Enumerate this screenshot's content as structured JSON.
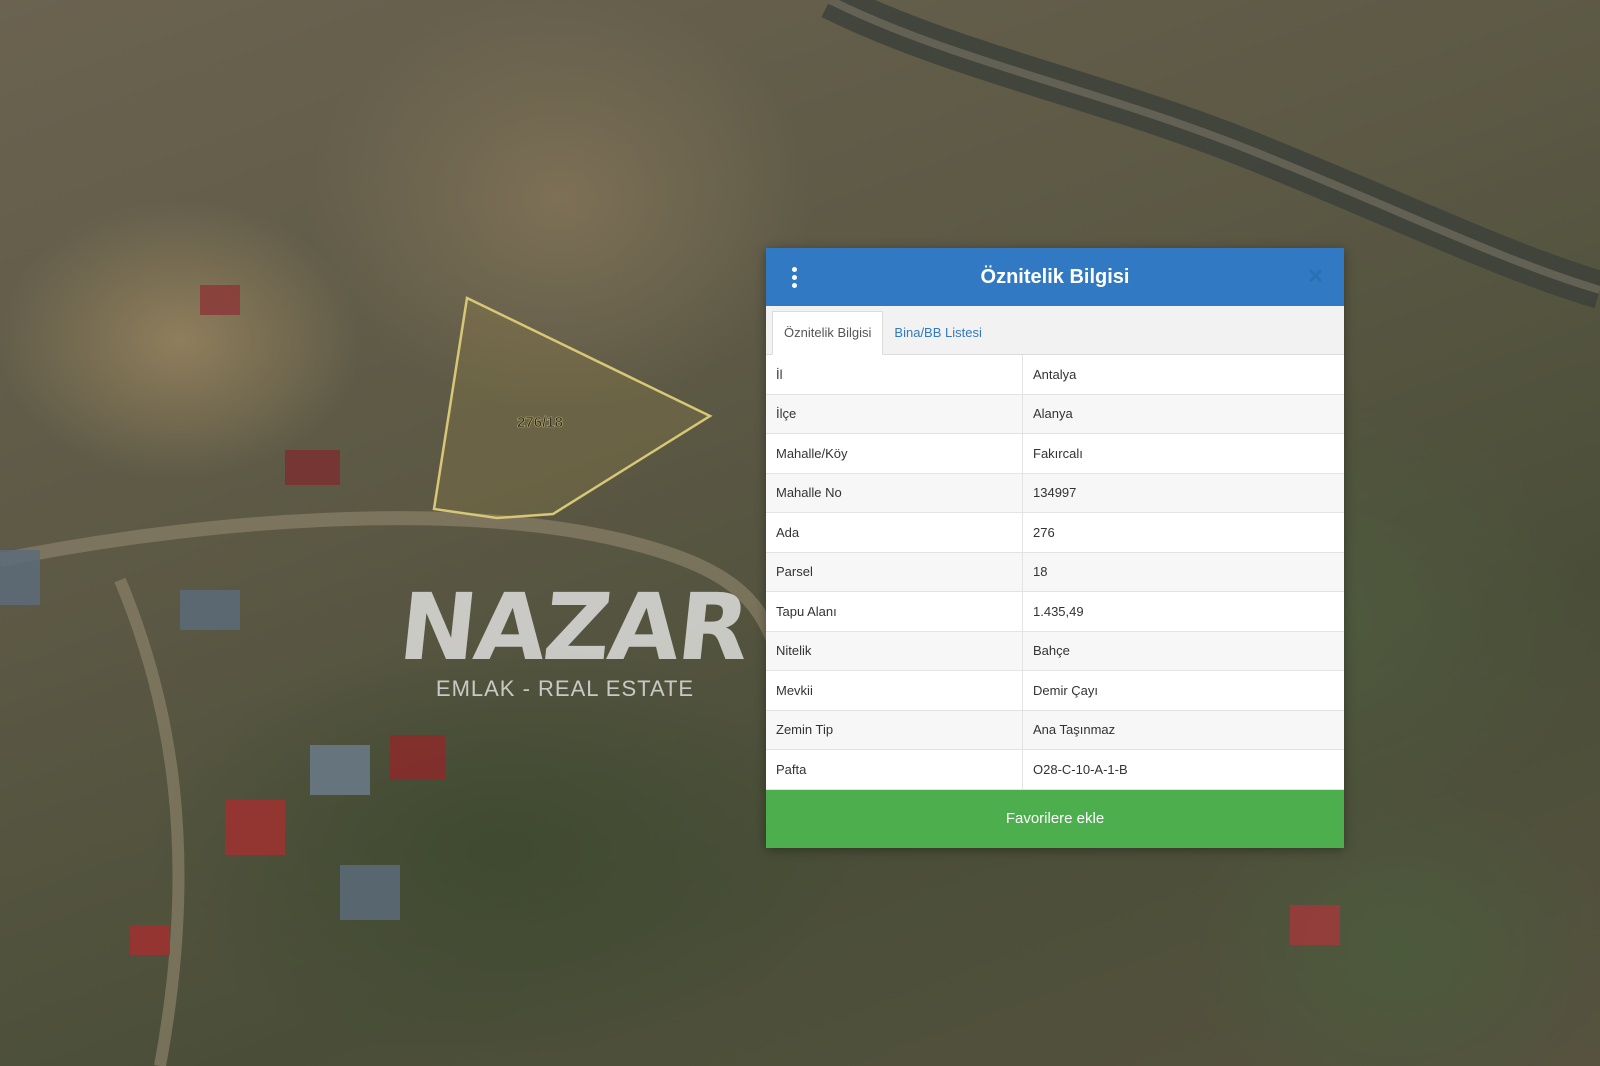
{
  "map": {
    "parcel_label": "276/18"
  },
  "watermark": {
    "logo": "NAZAR",
    "tagline": "EMLAK - REAL ESTATE"
  },
  "dialog": {
    "title": "Öznitelik Bilgisi",
    "tabs": [
      {
        "label": "Öznitelik Bilgisi",
        "active": true
      },
      {
        "label": "Bina/BB Listesi",
        "active": false
      }
    ],
    "rows": [
      {
        "key": "İl",
        "value": "Antalya"
      },
      {
        "key": "İlçe",
        "value": "Alanya"
      },
      {
        "key": "Mahalle/Köy",
        "value": "Fakırcalı"
      },
      {
        "key": "Mahalle No",
        "value": "134997"
      },
      {
        "key": "Ada",
        "value": "276"
      },
      {
        "key": "Parsel",
        "value": "18"
      },
      {
        "key": "Tapu Alanı",
        "value": "1.435,49"
      },
      {
        "key": "Nitelik",
        "value": "Bahçe"
      },
      {
        "key": "Mevkii",
        "value": "Demir Çayı"
      },
      {
        "key": "Zemin Tip",
        "value": "Ana Taşınmaz"
      },
      {
        "key": "Pafta",
        "value": "O28-C-10-A-1-B"
      }
    ],
    "favorite_button": "Favorilere ekle",
    "close_icon": "close-icon",
    "menu_icon": "vertical-dots-icon"
  },
  "colors": {
    "header": "#3179c2",
    "favorite_button": "#4cae4c",
    "parcel_outline": "#d8c777"
  }
}
